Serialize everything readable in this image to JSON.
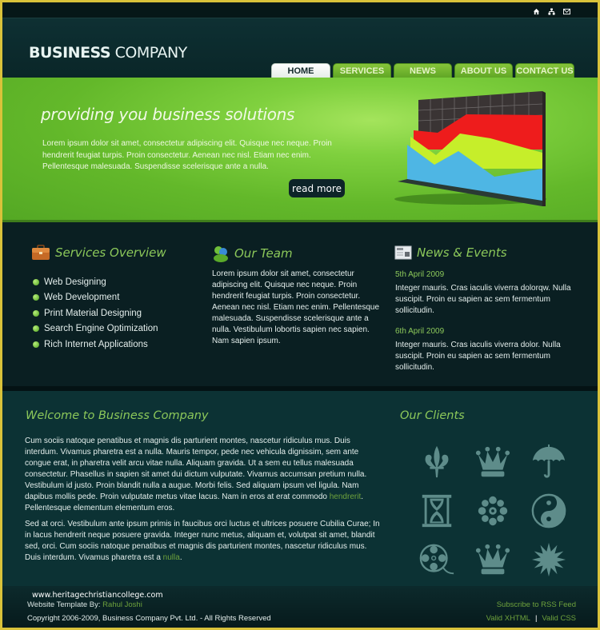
{
  "header": {
    "logo_bold": "BUSINESS",
    "logo_light": " COMPANY",
    "top_icons": [
      "home-icon",
      "sitemap-icon",
      "mail-icon"
    ]
  },
  "nav": {
    "tabs": [
      {
        "label": "HOME",
        "active": true
      },
      {
        "label": "SERVICES",
        "active": false
      },
      {
        "label": "NEWS",
        "active": false
      },
      {
        "label": "ABOUT US",
        "active": false
      },
      {
        "label": "CONTACT US",
        "active": false
      }
    ]
  },
  "banner": {
    "title": "providing you business solutions",
    "text": "Lorem ipsum dolor sit amet, consectetur adipiscing elit. Quisque nec neque. Proin hendrerit feugiat turpis. Proin consectetur. Aenean nec nisl. Etiam nec enim. Pellentesque malesuada. Suspendisse scelerisque ante a nulla.",
    "button": "read more",
    "chart_icon": "area-chart-illustration",
    "colors": {
      "blue": "#4eb6e4",
      "yellow": "#c6ee2a",
      "red": "#ee1c1c",
      "grid": "#3a3434"
    }
  },
  "services": {
    "title": "Services Overview",
    "icon": "briefcase-icon",
    "items": [
      "Web Designing",
      "Web Development",
      "Print Material Designing",
      "Search Engine Optimization",
      "Rich Internet Applications"
    ]
  },
  "team": {
    "title": "Our Team",
    "icon": "team-icon",
    "text": "Lorem ipsum dolor sit amet, consectetur adipiscing elit. Quisque nec neque. Proin hendrerit feugiat turpis. Proin consectetur. Aenean nec nisl. Etiam nec enim. Pellentesque malesuada. Suspendisse scelerisque ante a nulla. Vestibulum lobortis sapien nec sapien. Nam sapien ipsum."
  },
  "news": {
    "title": "News & Events",
    "icon": "newspaper-icon",
    "items": [
      {
        "date": "5th April 2009",
        "text": "Integer mauris. Cras iaculis viverra dolorqw. Nulla suscipit. Proin eu sapien ac sem fermentum sollicitudin."
      },
      {
        "date": "6th April 2009",
        "text": "Integer mauris. Cras iaculis viverra dolor. Nulla suscipit. Proin eu sapien ac sem fermentum sollicitudin."
      }
    ]
  },
  "welcome": {
    "title": "Welcome to Business Company",
    "para1": "Cum sociis natoque penatibus et magnis dis parturient montes, nascetur ridiculus mus. Duis interdum. Vivamus pharetra est a nulla. Mauris tempor, pede nec vehicula dignissim, sem ante congue erat, in pharetra velit arcu vitae nulla. Aliquam gravida. Ut a sem eu tellus malesuada consectetur. Phasellus in sapien sit amet dui dictum vulputate. Vivamus accumsan pretium nulla. Vestibulum id justo. Proin blandit nulla a augue. Morbi felis. Sed aliquam ipsum vel ligula. Nam dapibus mollis pede. Proin vulputate metus vitae lacus. Nam in eros at erat commodo ",
    "para1_link": "hendrerit",
    "para1_tail": ". Pellentesque elementum elementum eros.",
    "para2": "Sed at orci. Vestibulum ante ipsum primis in faucibus orci luctus et ultrices posuere Cubilia Curae; In in lacus hendrerit neque posuere gravida. Integer nunc metus, aliquam et, volutpat sit amet, blandit sed, orci. Cum sociis natoque penatibus et magnis dis parturient montes, nascetur ridiculus mus. Duis interdum. Vivamus pharetra est a ",
    "para2_link": "nulla",
    "para2_tail": "."
  },
  "clients": {
    "title": "Our Clients",
    "logos": [
      "fleur-de-lis-icon",
      "crown-icon",
      "umbrella-icon",
      "hourglass-icon",
      "flower-icon",
      "yin-yang-icon",
      "film-reel-icon",
      "crown-icon",
      "starburst-icon"
    ],
    "icon_color": "#5e8c8a"
  },
  "footer": {
    "site": "www.heritagechristiancollege.com",
    "by_label": "Website Template By: ",
    "by_link": "Rahul Joshi",
    "copyright": "Copyright 2006-2009, Business Company Pvt. Ltd. - All Rights Reserved",
    "rss": "Subscribe to RSS Feed",
    "valid_xhtml": "Valid XHTML",
    "separator": "|",
    "valid_css": "Valid CSS"
  }
}
